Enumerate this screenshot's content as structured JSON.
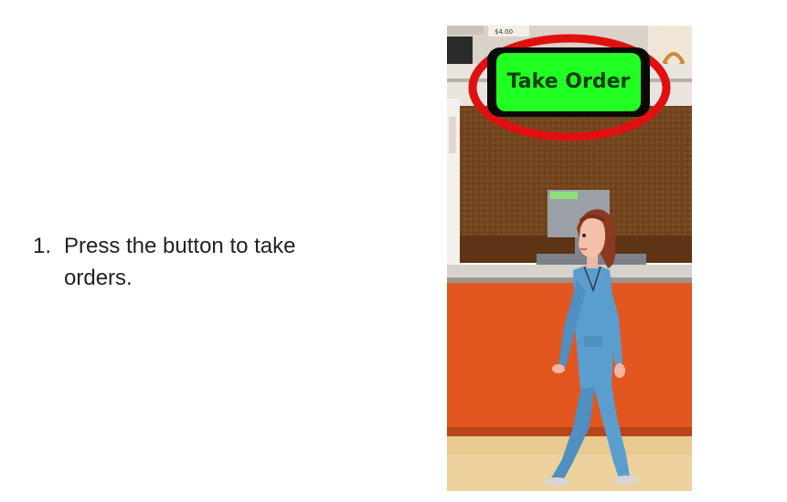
{
  "instruction": {
    "number": "1.",
    "line1": "Press the button to take",
    "line2": "orders."
  },
  "game": {
    "take_order_label": "Take Order",
    "menu_price_label": "$4.00",
    "colors": {
      "button_fill": "#22ff22",
      "button_border": "#0a0a0a",
      "highlight_ring": "#e01010",
      "counter_orange": "#e2561f",
      "wall_brown": "#7a4a22",
      "floor_tan": "#e8c98f",
      "uniform_blue": "#5a9ed0"
    }
  }
}
